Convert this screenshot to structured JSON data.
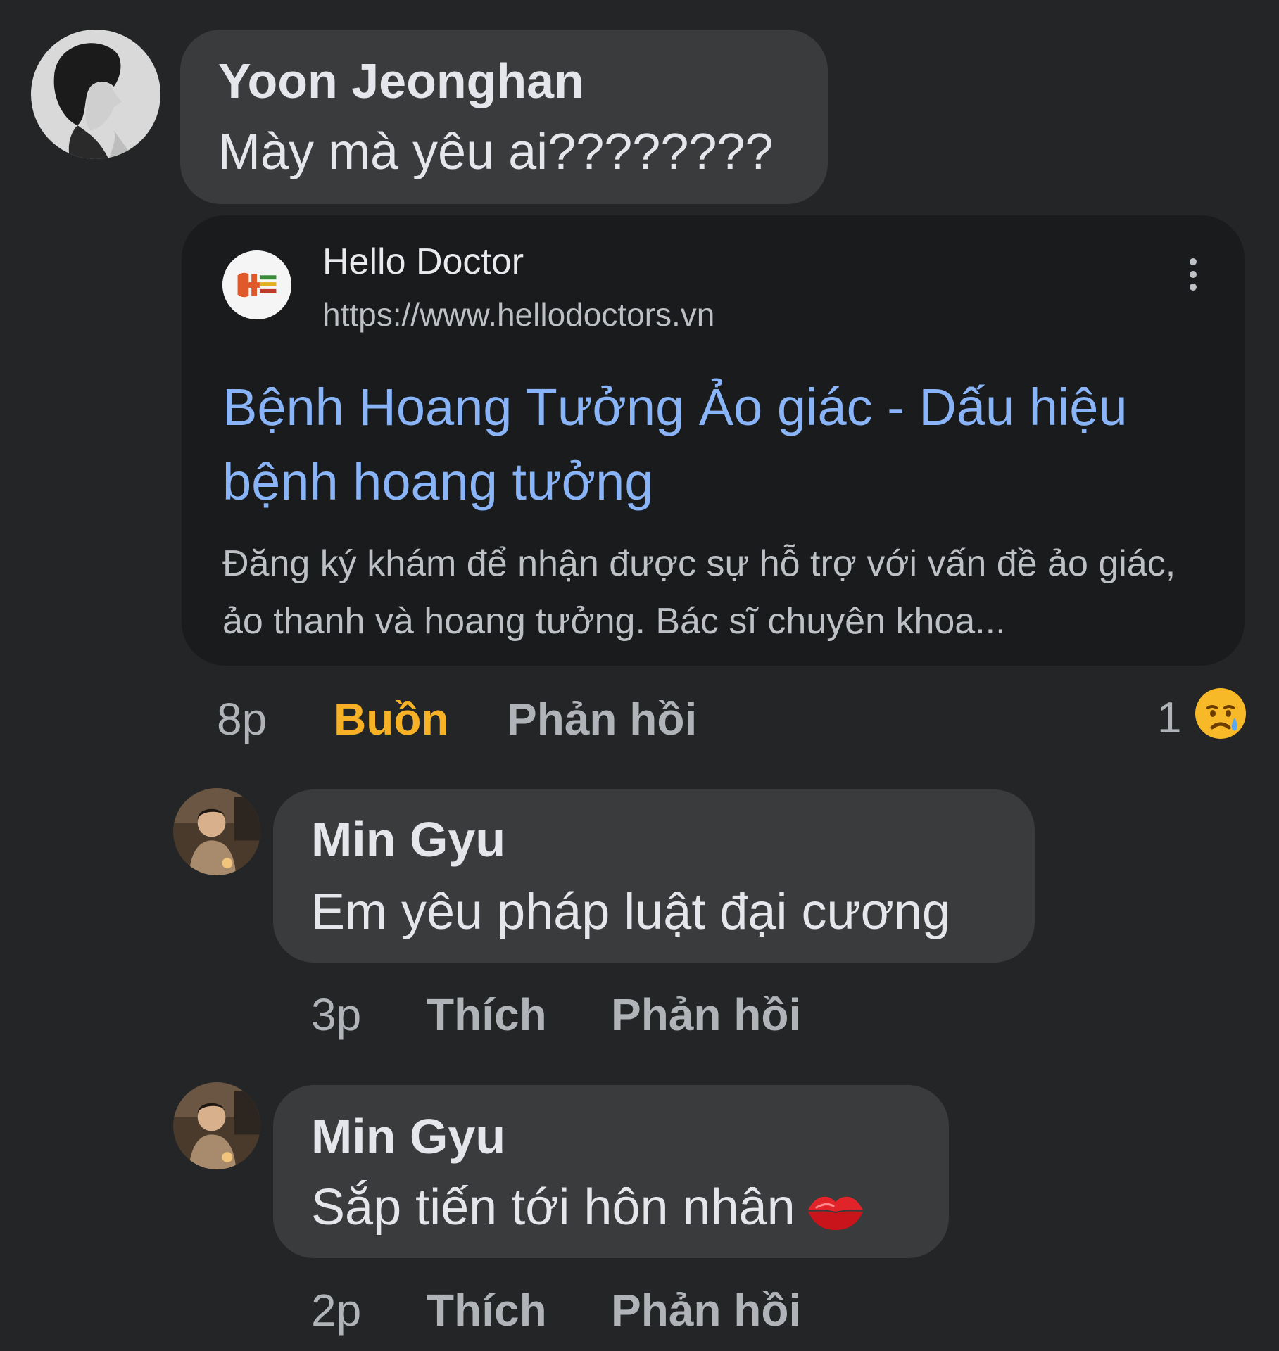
{
  "comments": [
    {
      "author": "Yoon Jeonghan",
      "text": "Mày mà yêu ai????????",
      "attachment": {
        "site_name": "Hello Doctor",
        "site_url": "https://www.hellodoctors.vn",
        "title": "Bệnh Hoang Tưởng Ảo giác - Dấu hiệu bệnh hoang tưởng",
        "snippet": "Đăng ký khám để nhận được sự hỗ trợ với vấn đề ảo giác, ảo thanh và hoang tưởng. Bác sĩ chuyên khoa..."
      },
      "time": "8p",
      "reaction_label": "Buồn",
      "reply_label": "Phản hồi",
      "reaction_count": "1",
      "reaction_icon": "crying-face-icon"
    },
    {
      "author": "Min Gyu",
      "text": "Em yêu pháp luật đại cương",
      "time": "3p",
      "like_label": "Thích",
      "reply_label": "Phản hồi"
    },
    {
      "author": "Min Gyu",
      "text": "Sắp tiến tới hôn nhân",
      "emoji": "kiss-mark-icon",
      "time": "2p",
      "like_label": "Thích",
      "reply_label": "Phản hồi"
    }
  ]
}
